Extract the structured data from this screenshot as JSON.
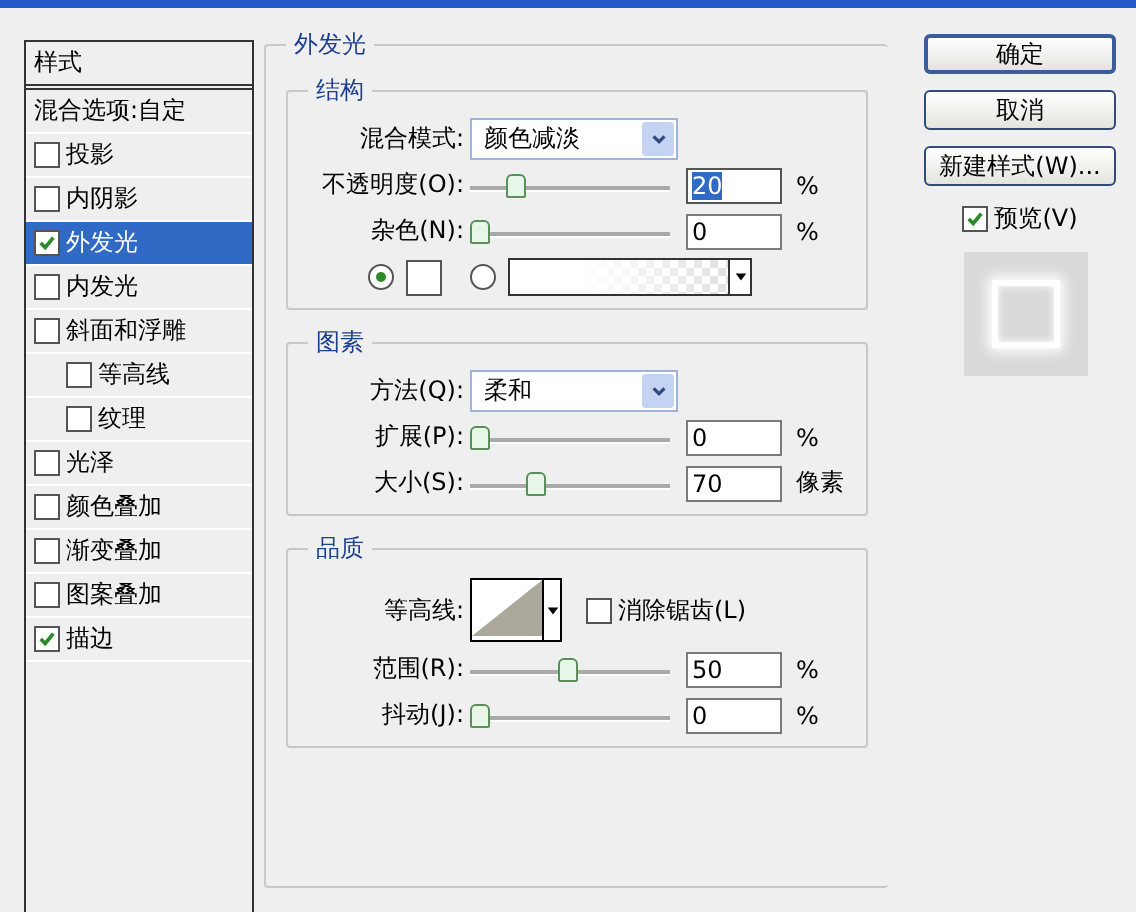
{
  "sidebar": {
    "header": "样式",
    "blending": "混合选项:自定",
    "items": [
      {
        "label": "投影",
        "checked": false,
        "selected": false
      },
      {
        "label": "内阴影",
        "checked": false,
        "selected": false
      },
      {
        "label": "外发光",
        "checked": true,
        "selected": true
      },
      {
        "label": "内发光",
        "checked": false,
        "selected": false
      },
      {
        "label": "斜面和浮雕",
        "checked": false,
        "selected": false,
        "children": [
          {
            "label": "等高线",
            "checked": false,
            "selected": false
          },
          {
            "label": "纹理",
            "checked": false,
            "selected": false
          }
        ]
      },
      {
        "label": "光泽",
        "checked": false,
        "selected": false
      },
      {
        "label": "颜色叠加",
        "checked": false,
        "selected": false
      },
      {
        "label": "渐变叠加",
        "checked": false,
        "selected": false
      },
      {
        "label": "图案叠加",
        "checked": false,
        "selected": false
      },
      {
        "label": "描边",
        "checked": true,
        "selected": false
      }
    ]
  },
  "panel": {
    "title": "外发光",
    "groups": [
      {
        "title": "结构",
        "rows": [
          {
            "kind": "dropdown",
            "label": "混合模式:",
            "value": "颜色减淡"
          },
          {
            "kind": "slider",
            "label": "不透明度(O):",
            "level": 0.2,
            "value": "20",
            "unit": "%",
            "highlighted": true
          },
          {
            "kind": "slider",
            "label": "杂色(N):",
            "level": 0,
            "value": "0",
            "unit": "%",
            "highlighted": false
          },
          {
            "kind": "fill",
            "options": [
              {
                "kind": "color",
                "selected": true
              },
              {
                "kind": "gradient",
                "selected": false
              }
            ]
          }
        ]
      },
      {
        "title": "图素",
        "rows": [
          {
            "kind": "dropdown",
            "label": "方法(Q):",
            "value": "柔和"
          },
          {
            "kind": "slider",
            "label": "扩展(P):",
            "level": 0,
            "value": "0",
            "unit": "%",
            "highlighted": false
          },
          {
            "kind": "slider",
            "label": "大小(S):",
            "level": 0.3,
            "value": "70",
            "unit": "像素",
            "highlighted": false
          }
        ]
      },
      {
        "title": "品质",
        "rows": [
          {
            "kind": "contour",
            "label": "等高线:",
            "checkbox": {
              "label": "消除锯齿(L)",
              "checked": false
            }
          },
          {
            "kind": "slider",
            "label": "范围(R):",
            "level": 0.48,
            "value": "50",
            "unit": "%",
            "highlighted": false
          },
          {
            "kind": "slider",
            "label": "抖动(J):",
            "level": 0,
            "value": "0",
            "unit": "%",
            "highlighted": false
          }
        ]
      }
    ]
  },
  "buttons": [
    {
      "label": "确定",
      "default": true
    },
    {
      "label": "取消",
      "default": false
    },
    {
      "label": "新建样式(W)..."
    }
  ],
  "preview": {
    "label": "预览(V)",
    "checked": true
  }
}
